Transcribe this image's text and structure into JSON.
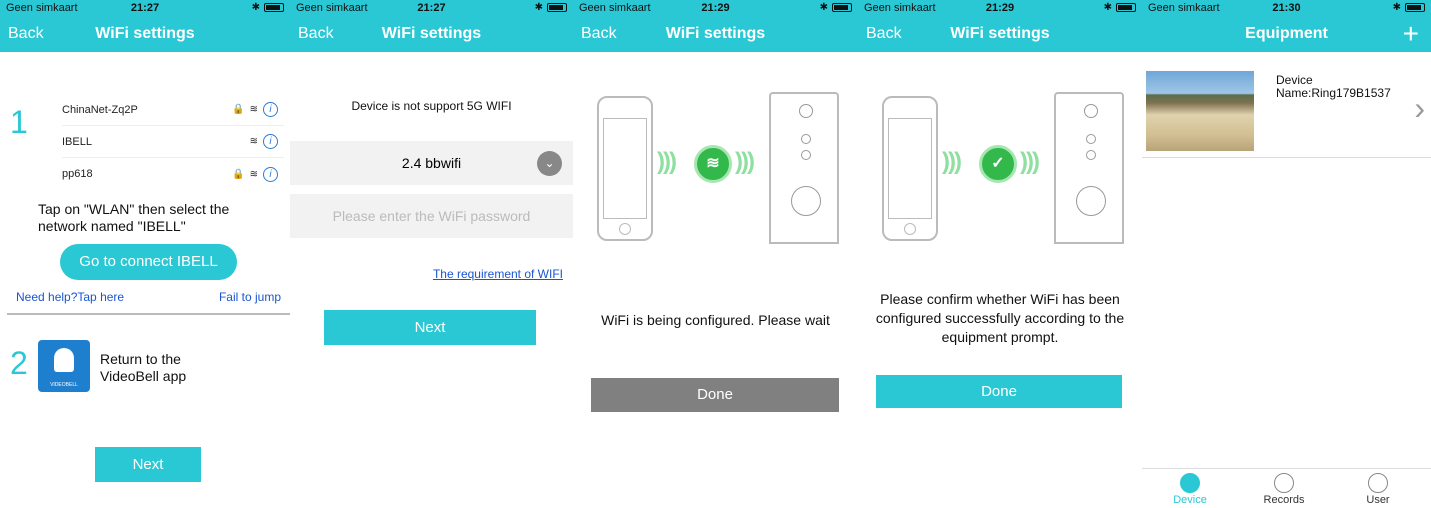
{
  "screen1": {
    "carrier": "Geen simkaart",
    "time": "21:27",
    "back": "Back",
    "title": "WiFi settings",
    "step1": "1",
    "networks": [
      {
        "ssid": "ChinaNet-Zq2P",
        "locked": true
      },
      {
        "ssid": "IBELL",
        "locked": false
      },
      {
        "ssid": "pp618",
        "locked": true
      }
    ],
    "instruction": "Tap on \"WLAN\" then select the network named \"IBELL\"",
    "connect_button": "Go to connect IBELL",
    "help_link": "Need help?Tap here",
    "fail_link": "Fail to jump",
    "step2": "2",
    "app_label": "VIDEOBELL",
    "return_text": "Return to the VideoBell app",
    "next_button": "Next"
  },
  "screen2": {
    "carrier": "Geen simkaart",
    "time": "21:27",
    "back": "Back",
    "title": "WiFi settings",
    "notice": "Device is not support 5G WIFI",
    "selected_ssid": "2.4 bbwifi",
    "password_placeholder": "Please enter the WiFi password",
    "requirement_link": "The requirement of WIFI",
    "next_button": "Next"
  },
  "screen3": {
    "carrier": "Geen simkaart",
    "time": "21:29",
    "back": "Back",
    "title": "WiFi settings",
    "status": "WiFi is being configured. Please wait",
    "done_button": "Done",
    "done_color": "#808080"
  },
  "screen4": {
    "carrier": "Geen simkaart",
    "time": "21:29",
    "back": "Back",
    "title": "WiFi settings",
    "message": "Please confirm whether WiFi has been configured successfully according to the equipment prompt.",
    "done_button": "Done"
  },
  "screen5": {
    "carrier": "Geen simkaart",
    "time": "21:30",
    "title": "Equipment",
    "add": "+",
    "device_label": "Device",
    "device_name": "Name:Ring179B1537",
    "tabs": [
      {
        "label": "Device",
        "active": true
      },
      {
        "label": "Records",
        "active": false
      },
      {
        "label": "User",
        "active": false
      }
    ]
  },
  "colors": {
    "accent": "#2ac8d4",
    "link": "#1a55d0",
    "success": "#33b84c"
  }
}
